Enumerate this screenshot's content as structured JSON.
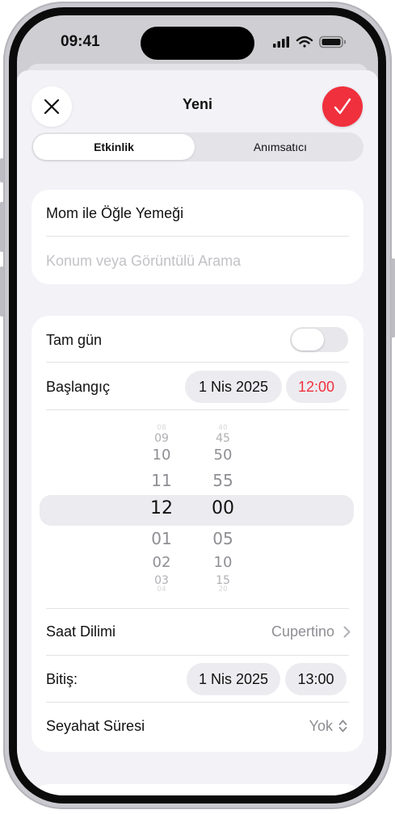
{
  "status_bar": {
    "time": "09:41"
  },
  "nav": {
    "title": "Yeni"
  },
  "segments": {
    "event": "Etkinlik",
    "reminder": "Anımsatıcı"
  },
  "details": {
    "title_value": "Mom ile Öğle Yemeği",
    "location_placeholder": "Konum veya Görüntülü Arama"
  },
  "all_day": {
    "label": "Tam gün",
    "enabled": false
  },
  "start": {
    "label": "Başlangıç",
    "date": "1 Nis 2025",
    "time": "12:00"
  },
  "time_picker": {
    "hours": [
      "08",
      "09",
      "10",
      "11",
      "12",
      "01",
      "02",
      "03",
      "04"
    ],
    "minutes": [
      "40",
      "45",
      "50",
      "55",
      "00",
      "05",
      "10",
      "15",
      "20"
    ],
    "selected_hour": "12",
    "selected_minute": "00"
  },
  "time_zone": {
    "label": "Saat Dilimi",
    "value": "Cupertino"
  },
  "end": {
    "label": "Bitiş:",
    "date": "1 Nis 2025",
    "time": "13:00"
  },
  "travel_time": {
    "label": "Seyahat Süresi",
    "value": "Yok"
  },
  "colors": {
    "accent": "#f0303d",
    "background": "#f2f2f7",
    "card": "#ffffff",
    "secondary_text": "#8e8e93"
  },
  "icons": {
    "close": "close-icon",
    "done": "checkmark-icon",
    "chevron": "chevron-right-icon",
    "updown": "chevron-up-down-icon",
    "signal": "cellular-signal-icon",
    "wifi": "wifi-icon",
    "battery": "battery-icon"
  }
}
